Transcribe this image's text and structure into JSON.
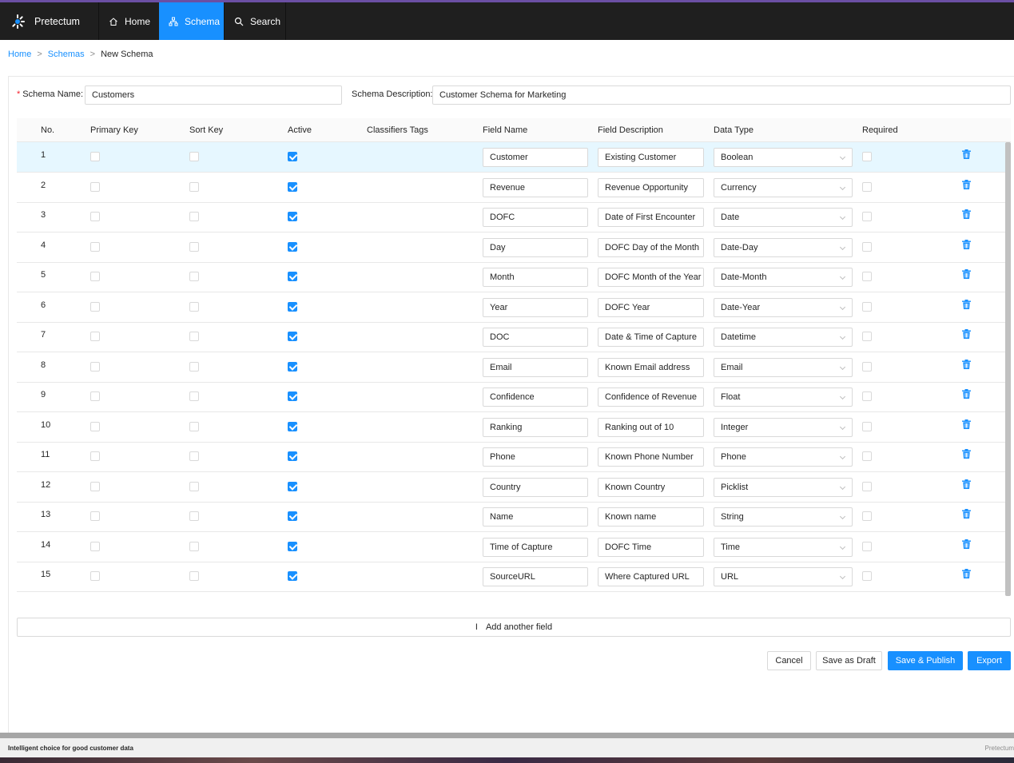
{
  "app": {
    "name": "Pretectum"
  },
  "nav": {
    "home": "Home",
    "schema": "Schema",
    "search": "Search"
  },
  "breadcrumb": {
    "home": "Home",
    "schemas": "Schemas",
    "current": "New Schema",
    "sep": ">"
  },
  "form": {
    "schema_name_label": "Schema Name:",
    "schema_name_value": "Customers",
    "schema_description_label": "Schema Description:",
    "schema_description_value": "Customer Schema for Marketing",
    "required_marker": "*"
  },
  "table": {
    "headers": [
      "No.",
      "Primary Key",
      "Sort Key",
      "Active",
      "Classifiers Tags",
      "Field Name",
      "Field Description",
      "Data Type",
      "Required"
    ],
    "rows": [
      {
        "no": "1",
        "primary_key": false,
        "sort_key": false,
        "active": true,
        "field_name": "Customer",
        "field_description": "Existing Customer",
        "data_type": "Boolean",
        "required": false,
        "selected": true
      },
      {
        "no": "2",
        "primary_key": false,
        "sort_key": false,
        "active": true,
        "field_name": "Revenue",
        "field_description": "Revenue Opportunity",
        "data_type": "Currency",
        "required": false
      },
      {
        "no": "3",
        "primary_key": false,
        "sort_key": false,
        "active": true,
        "field_name": "DOFC",
        "field_description": "Date of First Encounter",
        "data_type": "Date",
        "required": false
      },
      {
        "no": "4",
        "primary_key": false,
        "sort_key": false,
        "active": true,
        "field_name": "Day",
        "field_description": "DOFC Day of the Month",
        "data_type": "Date-Day",
        "required": false
      },
      {
        "no": "5",
        "primary_key": false,
        "sort_key": false,
        "active": true,
        "field_name": "Month",
        "field_description": "DOFC Month of the Year",
        "data_type": "Date-Month",
        "required": false
      },
      {
        "no": "6",
        "primary_key": false,
        "sort_key": false,
        "active": true,
        "field_name": "Year",
        "field_description": "DOFC Year",
        "data_type": "Date-Year",
        "required": false
      },
      {
        "no": "7",
        "primary_key": false,
        "sort_key": false,
        "active": true,
        "field_name": "DOC",
        "field_description": "Date & Time of Capture",
        "data_type": "Datetime",
        "required": false
      },
      {
        "no": "8",
        "primary_key": false,
        "sort_key": false,
        "active": true,
        "field_name": "Email",
        "field_description": "Known Email address",
        "data_type": "Email",
        "required": false
      },
      {
        "no": "9",
        "primary_key": false,
        "sort_key": false,
        "active": true,
        "field_name": "Confidence",
        "field_description": "Confidence of Revenue",
        "data_type": "Float",
        "required": false
      },
      {
        "no": "10",
        "primary_key": false,
        "sort_key": false,
        "active": true,
        "field_name": "Ranking",
        "field_description": "Ranking out of 10",
        "data_type": "Integer",
        "required": false
      },
      {
        "no": "11",
        "primary_key": false,
        "sort_key": false,
        "active": true,
        "field_name": "Phone",
        "field_description": "Known Phone Number",
        "data_type": "Phone",
        "required": false
      },
      {
        "no": "12",
        "primary_key": false,
        "sort_key": false,
        "active": true,
        "field_name": "Country",
        "field_description": "Known Country",
        "data_type": "Picklist",
        "required": false
      },
      {
        "no": "13",
        "primary_key": false,
        "sort_key": false,
        "active": true,
        "field_name": "Name",
        "field_description": "Known name",
        "data_type": "String",
        "required": false
      },
      {
        "no": "14",
        "primary_key": false,
        "sort_key": false,
        "active": true,
        "field_name": "Time of Capture",
        "field_description": "DOFC Time",
        "data_type": "Time",
        "required": false
      },
      {
        "no": "15",
        "primary_key": false,
        "sort_key": false,
        "active": true,
        "field_name": "SourceURL",
        "field_description": "Where Captured URL",
        "data_type": "URL",
        "required": false
      }
    ]
  },
  "add_field": {
    "plus": "I",
    "label": "Add another field"
  },
  "buttons": {
    "cancel": "Cancel",
    "save_draft": "Save as Draft",
    "save_publish": "Save & Publish",
    "export": "Export"
  },
  "footer": {
    "tagline": "Intelligent choice for good customer data",
    "brand": "Pretectum"
  },
  "colors": {
    "accent": "#1890ff",
    "navbar": "#1f1f1f",
    "selected_row": "#e6f7ff",
    "required": "#f5222d"
  },
  "icons": {
    "logo": "pretectum-logo-icon",
    "home": "home-icon",
    "schema": "schema-icon",
    "search": "search-icon",
    "delete": "trash-icon",
    "dropdown": "chevron-down-icon"
  }
}
